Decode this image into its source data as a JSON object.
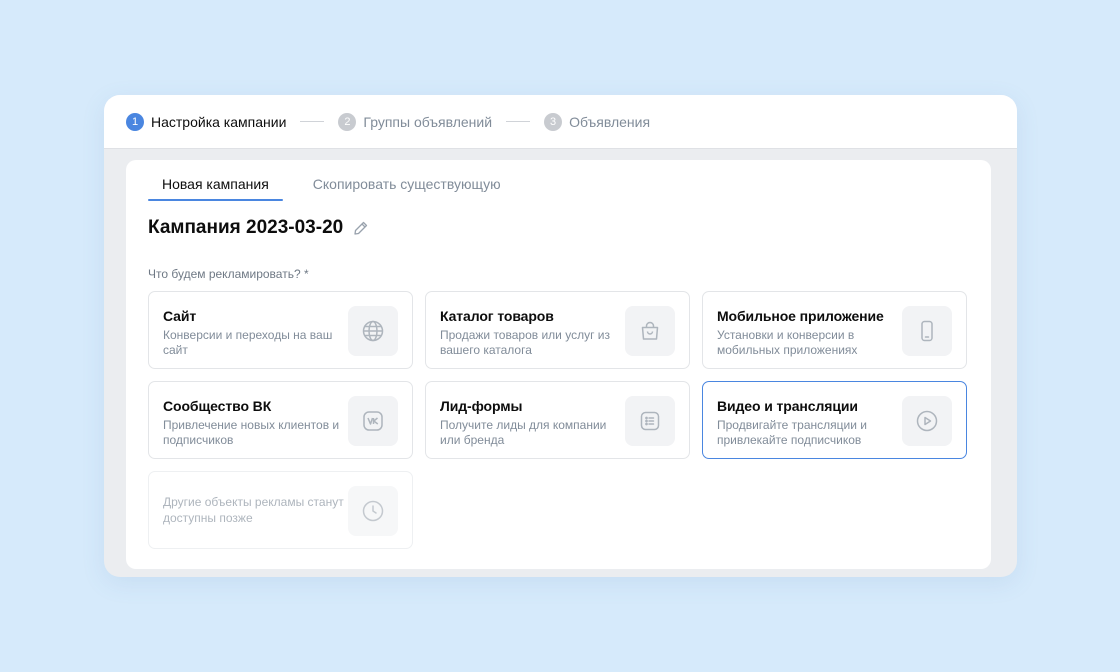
{
  "stepper": {
    "steps": [
      {
        "number": "1",
        "label": "Настройка кампании"
      },
      {
        "number": "2",
        "label": "Группы объявлений"
      },
      {
        "number": "3",
        "label": "Объявления"
      }
    ]
  },
  "tabs": [
    {
      "label": "Новая кампания"
    },
    {
      "label": "Скопировать существующую"
    }
  ],
  "campaign": {
    "title": "Кампания 2023-03-20"
  },
  "question": "Что будем рекламировать? *",
  "cards": [
    {
      "title": "Сайт",
      "desc": "Конверсии и переходы на ваш сайт",
      "icon": "globe-icon"
    },
    {
      "title": "Каталог товаров",
      "desc": "Продажи товаров или услуг из вашего каталога",
      "icon": "shopping-bag-icon"
    },
    {
      "title": "Мобильное приложение",
      "desc": "Установки и конверсии в мобильных приложениях",
      "icon": "smartphone-icon"
    },
    {
      "title": "Сообщество ВК",
      "desc": "Привлечение новых клиентов и подписчиков",
      "icon": "vk-logo-icon"
    },
    {
      "title": "Лид-формы",
      "desc": "Получите лиды для компании или бренда",
      "icon": "form-list-icon"
    },
    {
      "title": "Видео и трансляции",
      "desc": "Продвигайте трансляции и привлекайте подписчиков",
      "icon": "play-circle-icon"
    },
    {
      "title": "",
      "desc": "Другие объекты рекламы станут доступны позже",
      "icon": "clock-icon"
    }
  ],
  "colors": {
    "accent": "#4a86e0",
    "background": "#d6eafb",
    "muted_text": "#818c99",
    "icon": "#aeb5bd"
  }
}
